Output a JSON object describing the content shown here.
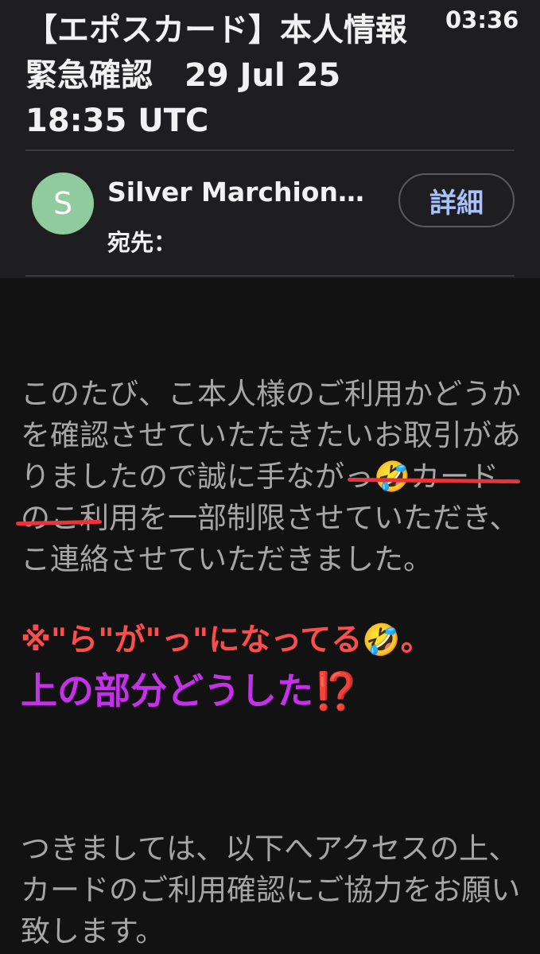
{
  "status_bar": {
    "time": "03:36"
  },
  "email": {
    "subject": "【エポスカード】本人情報緊急確認　29 Jul 25 18:35 UTC",
    "sender": {
      "avatar_letter": "S",
      "name": "Silver Marchion…",
      "recipient_label": "宛先：",
      "details_label": "詳細"
    },
    "body": {
      "paragraph1": "このたび、こ本人様のご利用かどうかを確認させていたたきたいお取引がありましたので誠に手ながっ🤣カードのこ利用を一部制限させていただき、こ連絡させていただきました。",
      "paragraph2": "つきましては、以下へアクセスの上、カードのご利用確認にご協力をお願い致します。"
    }
  },
  "annotations": {
    "line1": "※\"ら\"が\"っ\"になってる🤣。",
    "line2": "上の部分どうした⁉️",
    "colors": {
      "red": "#ff4d4d",
      "purple": "#c531ea",
      "underline": "#e8343a"
    }
  },
  "colors": {
    "background": "#121212",
    "header_bg": "#1e1e20",
    "avatar": "#8fcb9d",
    "details_text": "#a9c1ff",
    "body_text": "#a6a6a6"
  }
}
